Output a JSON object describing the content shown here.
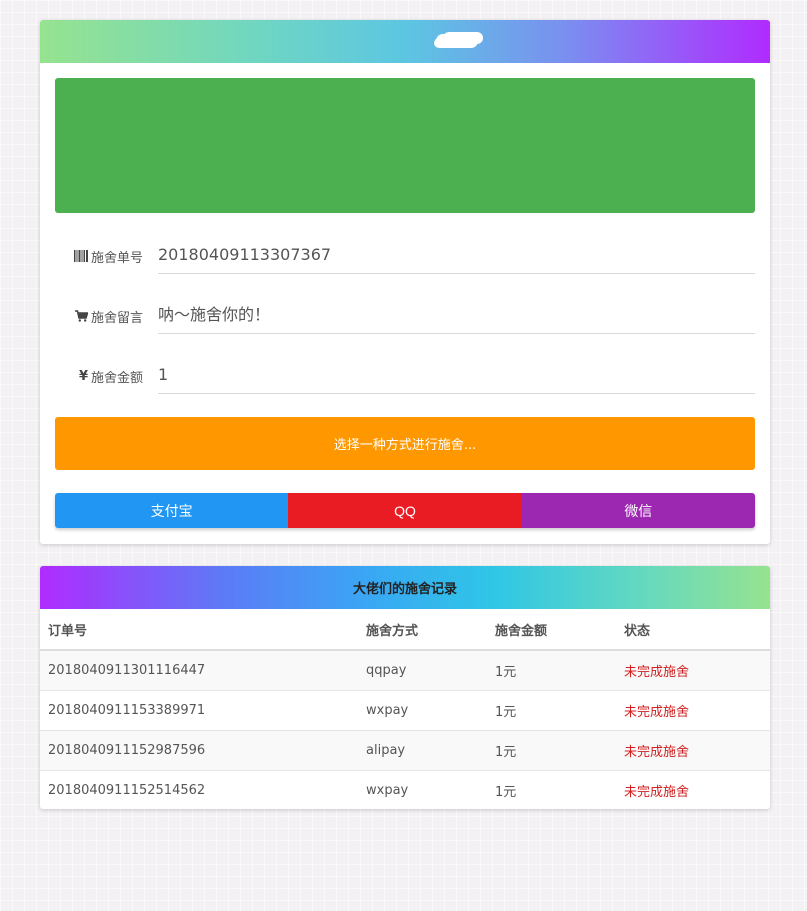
{
  "header": {
    "logo_icon": "cloud-icon"
  },
  "form": {
    "order": {
      "label": "施舍单号",
      "icon": "barcode-icon",
      "value": "20180409113307367"
    },
    "message": {
      "label": "施舍留言",
      "icon": "cart-icon",
      "value": "呐～施舍你的！"
    },
    "amount": {
      "label": "施舍金额",
      "icon": "yen-icon",
      "symbol": "¥",
      "value": "1"
    }
  },
  "choose_label": "选择一种方式进行施舍...",
  "payment": {
    "alipay": "支付宝",
    "qq": "QQ",
    "wechat": "微信"
  },
  "records": {
    "title": "大佬们的施舍记录",
    "columns": [
      "订单号",
      "施舍方式",
      "施舍金额",
      "状态"
    ],
    "rows": [
      {
        "order": "2018040911301116447",
        "method": "qqpay",
        "amount": "1元",
        "status": "未完成施舍"
      },
      {
        "order": "2018040911153389971",
        "method": "wxpay",
        "amount": "1元",
        "status": "未完成施舍"
      },
      {
        "order": "2018040911152987596",
        "method": "alipay",
        "amount": "1元",
        "status": "未完成施舍"
      },
      {
        "order": "2018040911152514562",
        "method": "wxpay",
        "amount": "1元",
        "status": "未完成施舍"
      }
    ]
  },
  "colors": {
    "banner": "#4caf50",
    "choose": "#ff9800",
    "alipay": "#2196f3",
    "qq": "#e91c24",
    "wechat": "#9c27b0",
    "status": "#d21f1f"
  }
}
